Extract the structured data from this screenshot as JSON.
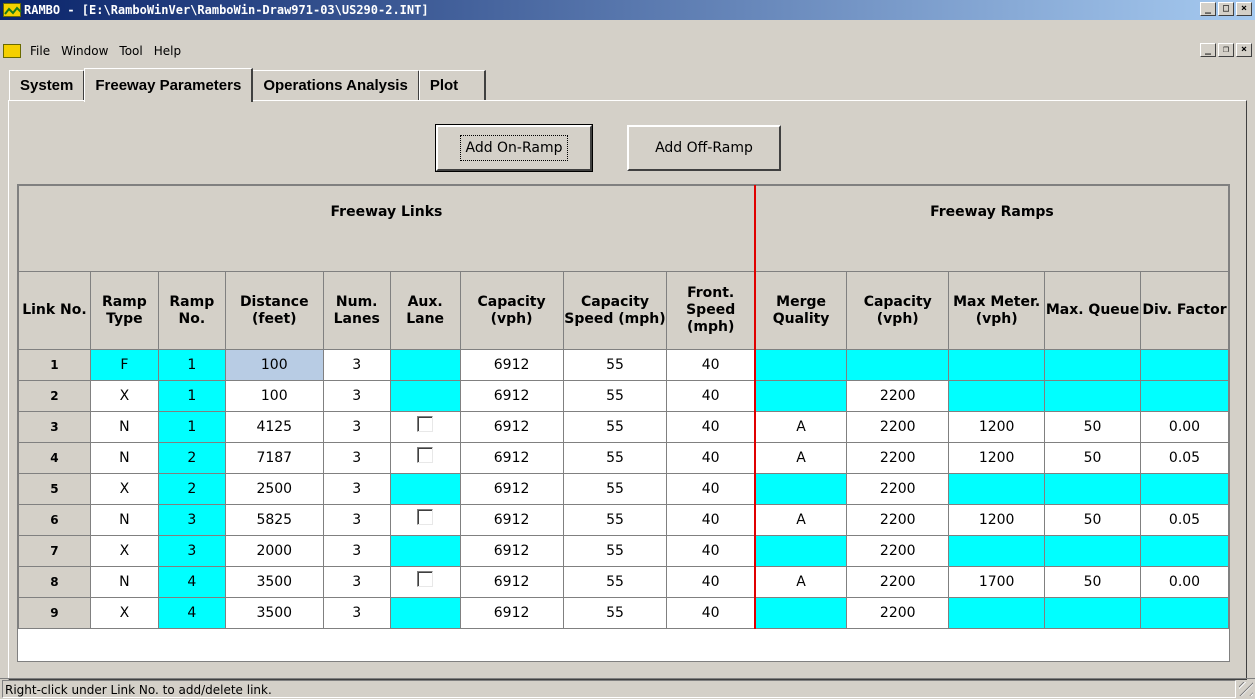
{
  "window": {
    "title": "RAMBO - [E:\\RamboWinVer\\RamboWin-Draw971-03\\US290-2.INT]",
    "controls": [
      "_",
      "□",
      "×"
    ],
    "mdi_controls": [
      "_",
      "❐",
      "×"
    ]
  },
  "menu": {
    "items": [
      "File",
      "Window",
      "Tool",
      "Help"
    ]
  },
  "tabs": [
    {
      "label": "System",
      "active": false
    },
    {
      "label": "Freeway Parameters",
      "active": true
    },
    {
      "label": "Operations Analysis",
      "active": false
    },
    {
      "label": "Plot",
      "active": false
    }
  ],
  "buttons": {
    "add_on_ramp": "Add On-Ramp",
    "add_off_ramp": "Add Off-Ramp"
  },
  "grid": {
    "group_headers": {
      "links": "Freeway Links",
      "ramps": "Freeway Ramps"
    },
    "columns": [
      "Link No.",
      "Ramp Type",
      "Ramp No.",
      "Distance (feet)",
      "Num. Lanes",
      "Aux. Lane",
      "Capacity (vph)",
      "Capacity Speed (mph)",
      "Front. Speed (mph)",
      "Merge Quality",
      "Capacity (vph)",
      "Max Meter. (vph)",
      "Max. Queue",
      "Div. Factor"
    ],
    "rows": [
      {
        "link": "1",
        "type": "F",
        "ramp": "1",
        "distance": "100",
        "lanes": "3",
        "aux": "none",
        "cap": "6912",
        "cap_speed": "55",
        "front_speed": "40",
        "merge": "",
        "rcap": "",
        "meter": "",
        "queue": "",
        "div": ""
      },
      {
        "link": "2",
        "type": "X",
        "ramp": "1",
        "distance": "100",
        "lanes": "3",
        "aux": "none",
        "cap": "6912",
        "cap_speed": "55",
        "front_speed": "40",
        "merge": "",
        "rcap": "2200",
        "meter": "",
        "queue": "",
        "div": ""
      },
      {
        "link": "3",
        "type": "N",
        "ramp": "1",
        "distance": "4125",
        "lanes": "3",
        "aux": "checkbox",
        "cap": "6912",
        "cap_speed": "55",
        "front_speed": "40",
        "merge": "A",
        "rcap": "2200",
        "meter": "1200",
        "queue": "50",
        "div": "0.00"
      },
      {
        "link": "4",
        "type": "N",
        "ramp": "2",
        "distance": "7187",
        "lanes": "3",
        "aux": "checkbox",
        "cap": "6912",
        "cap_speed": "55",
        "front_speed": "40",
        "merge": "A",
        "rcap": "2200",
        "meter": "1200",
        "queue": "50",
        "div": "0.05"
      },
      {
        "link": "5",
        "type": "X",
        "ramp": "2",
        "distance": "2500",
        "lanes": "3",
        "aux": "none",
        "cap": "6912",
        "cap_speed": "55",
        "front_speed": "40",
        "merge": "",
        "rcap": "2200",
        "meter": "",
        "queue": "",
        "div": ""
      },
      {
        "link": "6",
        "type": "N",
        "ramp": "3",
        "distance": "5825",
        "lanes": "3",
        "aux": "checkbox",
        "cap": "6912",
        "cap_speed": "55",
        "front_speed": "40",
        "merge": "A",
        "rcap": "2200",
        "meter": "1200",
        "queue": "50",
        "div": "0.05"
      },
      {
        "link": "7",
        "type": "X",
        "ramp": "3",
        "distance": "2000",
        "lanes": "3",
        "aux": "none",
        "cap": "6912",
        "cap_speed": "55",
        "front_speed": "40",
        "merge": "",
        "rcap": "2200",
        "meter": "",
        "queue": "",
        "div": ""
      },
      {
        "link": "8",
        "type": "N",
        "ramp": "4",
        "distance": "3500",
        "lanes": "3",
        "aux": "checkbox",
        "cap": "6912",
        "cap_speed": "55",
        "front_speed": "40",
        "merge": "A",
        "rcap": "2200",
        "meter": "1700",
        "queue": "50",
        "div": "0.00"
      },
      {
        "link": "9",
        "type": "X",
        "ramp": "4",
        "distance": "3500",
        "lanes": "3",
        "aux": "none",
        "cap": "6912",
        "cap_speed": "55",
        "front_speed": "40",
        "merge": "",
        "rcap": "2200",
        "meter": "",
        "queue": "",
        "div": ""
      }
    ]
  },
  "status": {
    "text": "Right-click under Link No. to add/delete link."
  },
  "colors": {
    "cyan_cell": "#00ffff",
    "selected_cell": "#b8cce4",
    "divider_red": "#e00000",
    "titlebar_start": "#0a246a",
    "titlebar_end": "#a6caf0"
  }
}
